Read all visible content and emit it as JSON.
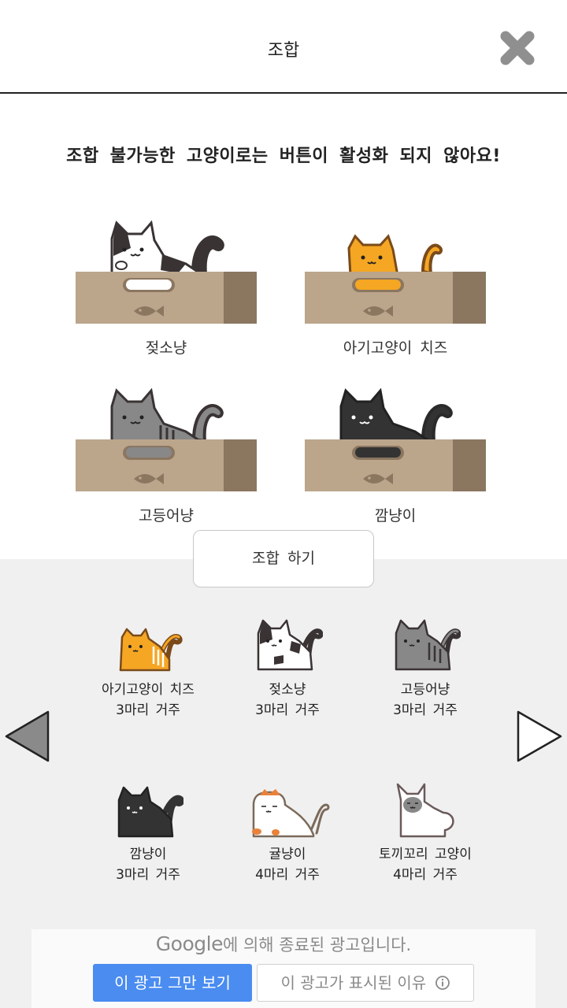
{
  "header": {
    "title": "조합"
  },
  "notice": "조합 불가능한 고양이로는 버튼이 활성화 되지 않아요!",
  "slots": [
    {
      "label": "젖소냥"
    },
    {
      "label": "아기고양이 치즈"
    },
    {
      "label": "고등어냥"
    },
    {
      "label": "깜냥이"
    }
  ],
  "combine_button": "조합 하기",
  "cats": [
    {
      "name": "아기고양이 치즈",
      "count": "3마리 거주"
    },
    {
      "name": "젖소냥",
      "count": "3마리 거주"
    },
    {
      "name": "고등어냥",
      "count": "3마리 거주"
    },
    {
      "name": "깜냥이",
      "count": "3마리 거주"
    },
    {
      "name": "귤냥이",
      "count": "4마리 거주"
    },
    {
      "name": "토끼꼬리 고양이",
      "count": "4마리 거주"
    }
  ],
  "ad": {
    "google": "Google",
    "text": "에 의해 종료된 광고입니다.",
    "stop_button": "이 광고 그만 보기",
    "why_button": "이 광고가 표시된 이유"
  },
  "colors": {
    "box": "#bba58b",
    "box_side": "#8b7660",
    "ad_blue": "#4a8cf0",
    "bottom_bg": "#f0f0f0"
  },
  "icons": {
    "close": "close-icon",
    "prev": "left-arrow-icon",
    "next": "right-arrow-icon",
    "info": "info-icon"
  }
}
